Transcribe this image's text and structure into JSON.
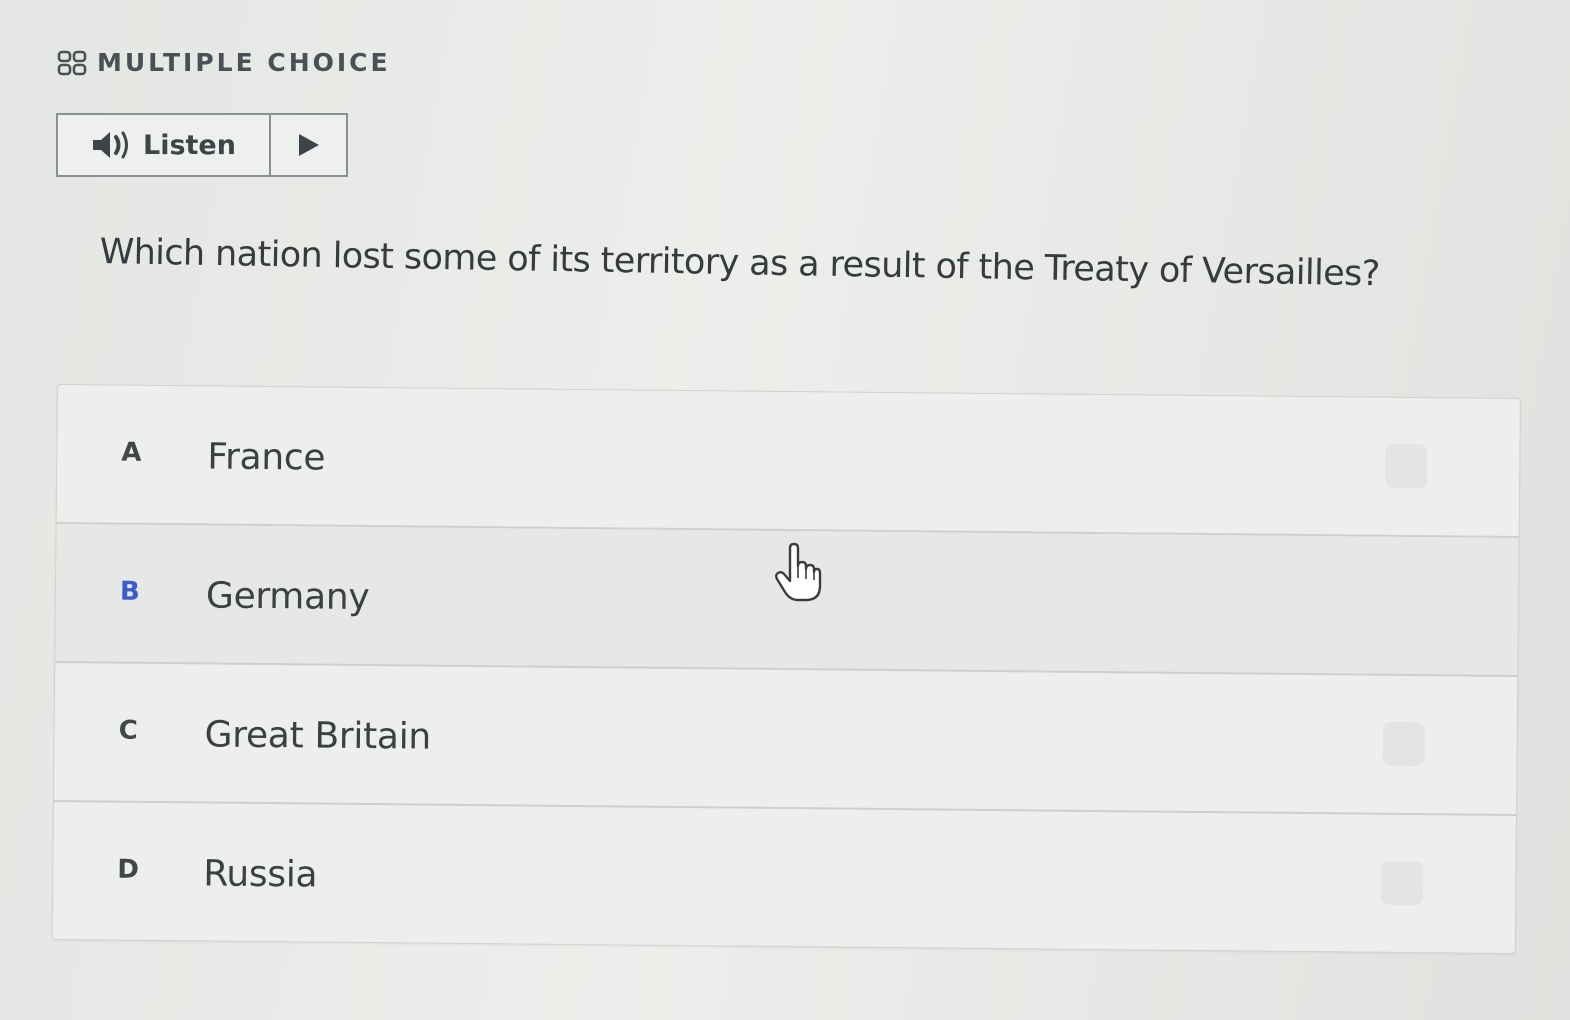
{
  "header": {
    "icon": "grid-icon",
    "title": "MULTIPLE CHOICE"
  },
  "listen": {
    "speaker_icon": "speaker-icon",
    "label": "Listen",
    "play_icon": "play-icon"
  },
  "question": {
    "text": "Which nation lost some of its territory as a result of the Treaty of Versailles?"
  },
  "answers": [
    {
      "letter": "A",
      "text": "France"
    },
    {
      "letter": "B",
      "text": "Germany"
    },
    {
      "letter": "C",
      "text": "Great Britain"
    },
    {
      "letter": "D",
      "text": "Russia"
    }
  ],
  "pointer": {
    "icon": "hand-cursor-icon"
  },
  "colors": {
    "accent_letter": "#3a5ec8",
    "text": "#3c4044",
    "border": "#8a8f94"
  }
}
